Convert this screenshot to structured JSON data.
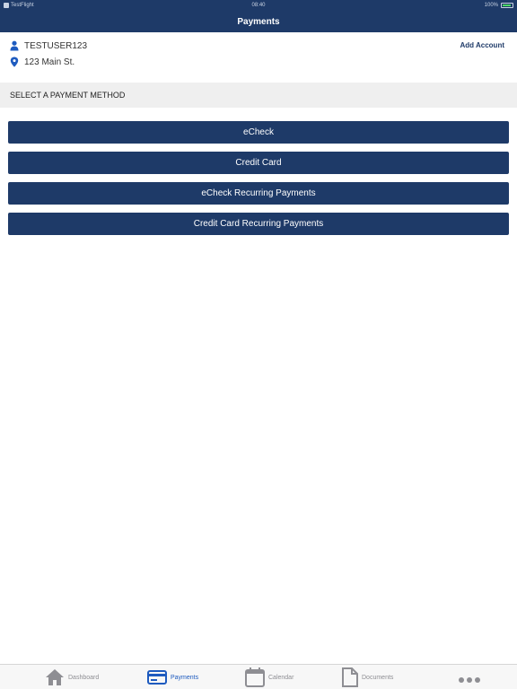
{
  "status_bar": {
    "app": "TestFlight",
    "time": "08:40",
    "battery": "100%"
  },
  "nav": {
    "title": "Payments"
  },
  "account": {
    "username": "TESTUSER123",
    "address": "123 Main St.",
    "add_account_label": "Add Account"
  },
  "section": {
    "header": "SELECT A PAYMENT METHOD"
  },
  "methods": [
    {
      "label": "eCheck"
    },
    {
      "label": "Credit Card"
    },
    {
      "label": "eCheck Recurring Payments"
    },
    {
      "label": "Credit Card Recurring Payments"
    }
  ],
  "tabs": [
    {
      "label": "Dashboard",
      "icon": "home-icon",
      "active": false
    },
    {
      "label": "Payments",
      "icon": "credit-card-icon",
      "active": true
    },
    {
      "label": "Calendar",
      "icon": "calendar-icon",
      "active": false
    },
    {
      "label": "Documents",
      "icon": "document-icon",
      "active": false
    },
    {
      "label": "",
      "icon": "more-icon",
      "active": false
    }
  ],
  "colors": {
    "brand": "#1e3a68",
    "active_tab": "#1e5bbf",
    "section_bg": "#efefef"
  }
}
